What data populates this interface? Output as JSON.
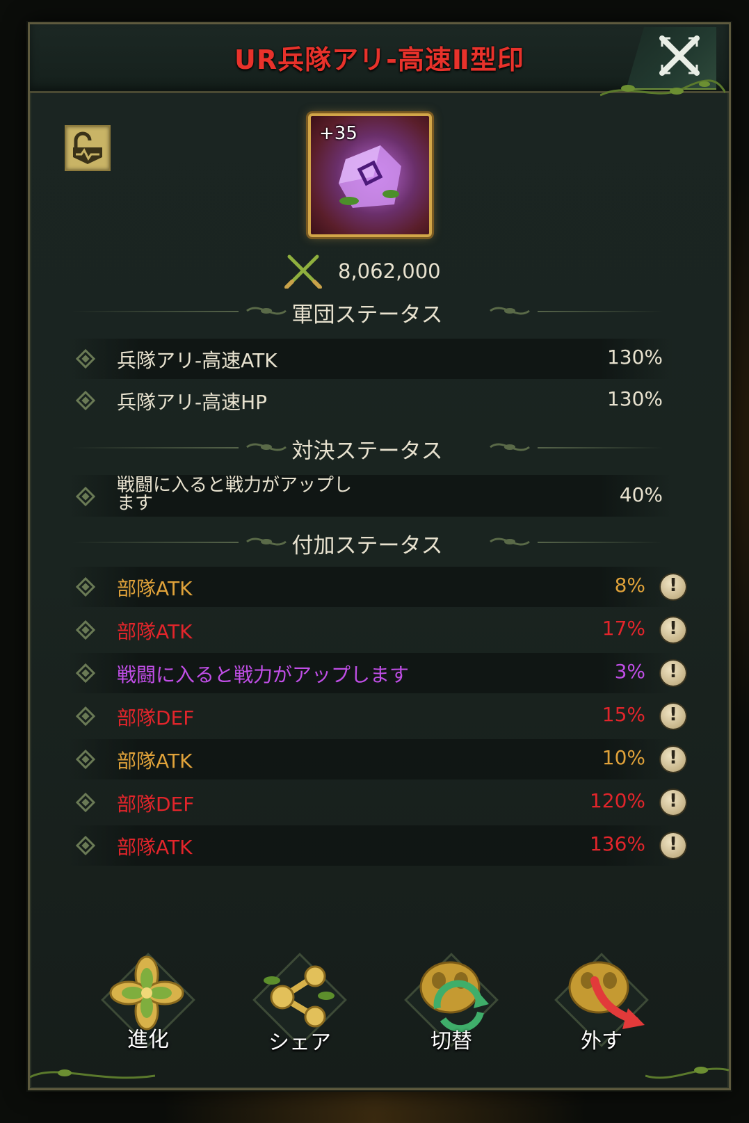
{
  "title": "UR兵隊アリ-高速Ⅱ型印",
  "item": {
    "level_badge": "+35",
    "power_icon": "crossed-swords-icon",
    "power": "8,062,000"
  },
  "sections": {
    "legion": "軍団ステータス",
    "duel": "対決ステータス",
    "extra": "付加ステータス"
  },
  "legion_stats": [
    {
      "name": "兵隊アリ-高速ATK",
      "value": "130%"
    },
    {
      "name": "兵隊アリ-高速HP",
      "value": "130%"
    }
  ],
  "duel_stats": [
    {
      "name": "戦闘に入ると戦力がアップし\nます",
      "value": "40%"
    }
  ],
  "extra_stats": [
    {
      "name": "部隊ATK",
      "value": "8%",
      "color": "#e0a23a"
    },
    {
      "name": "部隊ATK",
      "value": "17%",
      "color": "#e2252b"
    },
    {
      "name": "戦闘に入ると戦力がアップします",
      "value": "3%",
      "color": "#c04ee6"
    },
    {
      "name": "部隊DEF",
      "value": "15%",
      "color": "#e2252b"
    },
    {
      "name": "部隊ATK",
      "value": "10%",
      "color": "#e0a23a"
    },
    {
      "name": "部隊DEF",
      "value": "120%",
      "color": "#e2252b"
    },
    {
      "name": "部隊ATK",
      "value": "136%",
      "color": "#e2252b"
    }
  ],
  "info_glyph": "!",
  "actions": {
    "evolve": "進化",
    "share": "シェア",
    "swap": "切替",
    "remove": "外す"
  }
}
